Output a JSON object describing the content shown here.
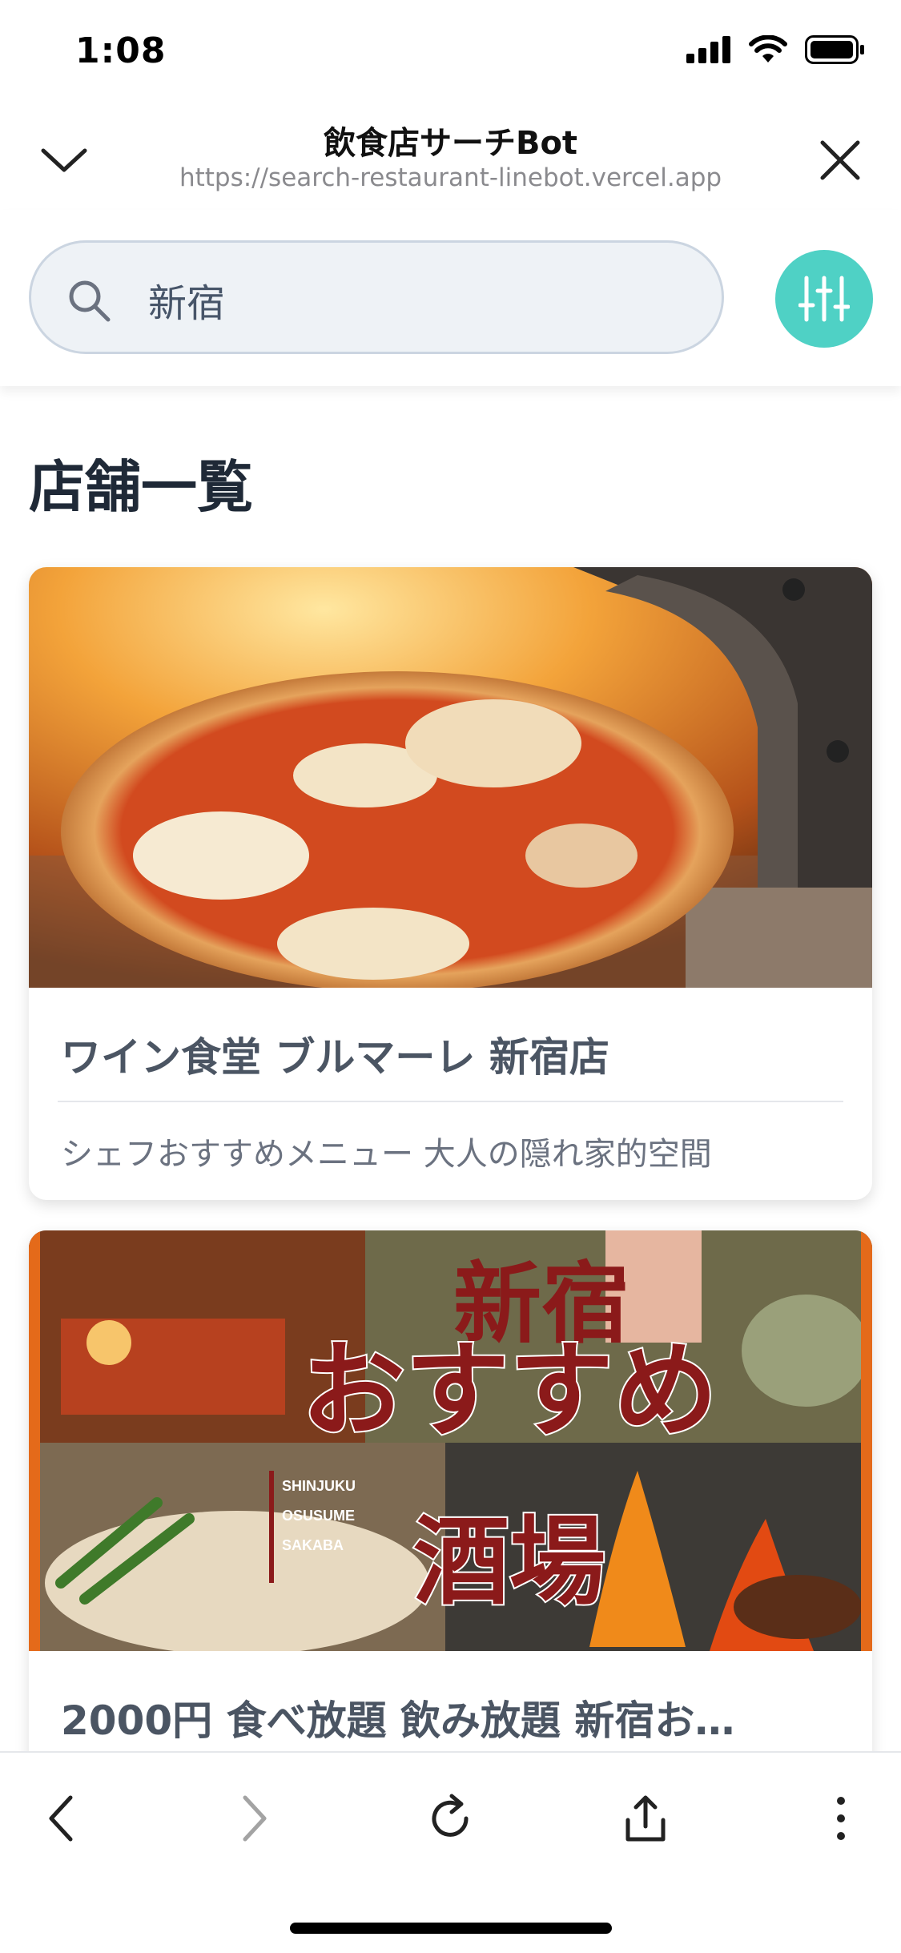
{
  "status_bar": {
    "time": "1:08"
  },
  "browser": {
    "title": "飲食店サーチBot",
    "url": "https://search-restaurant-linebot.vercel.app"
  },
  "search": {
    "value": "新宿"
  },
  "page": {
    "section_title": "店舗一覧"
  },
  "restaurants": [
    {
      "name": "ワイン食堂 ブルマーレ 新宿店",
      "description": "シェフおすすめメニュー 大人の隠れ家的空間",
      "image_icon": "pizza-photo"
    },
    {
      "name": "2000円 食べ放題 飲み放題 新宿お…",
      "description": "",
      "image_icon": "izakaya-photo",
      "image_text": {
        "title_line1": "新宿",
        "title_line2": "おすすめ",
        "title_line3": "酒場",
        "sub1": "SHINJUKU",
        "sub2": "OSUSUME",
        "sub3": "SAKABA"
      }
    }
  ],
  "colors": {
    "accent": "#4fd1c5",
    "search_bg": "#eef2f6",
    "title_text": "#1f2937",
    "card_title": "#4b5563"
  }
}
